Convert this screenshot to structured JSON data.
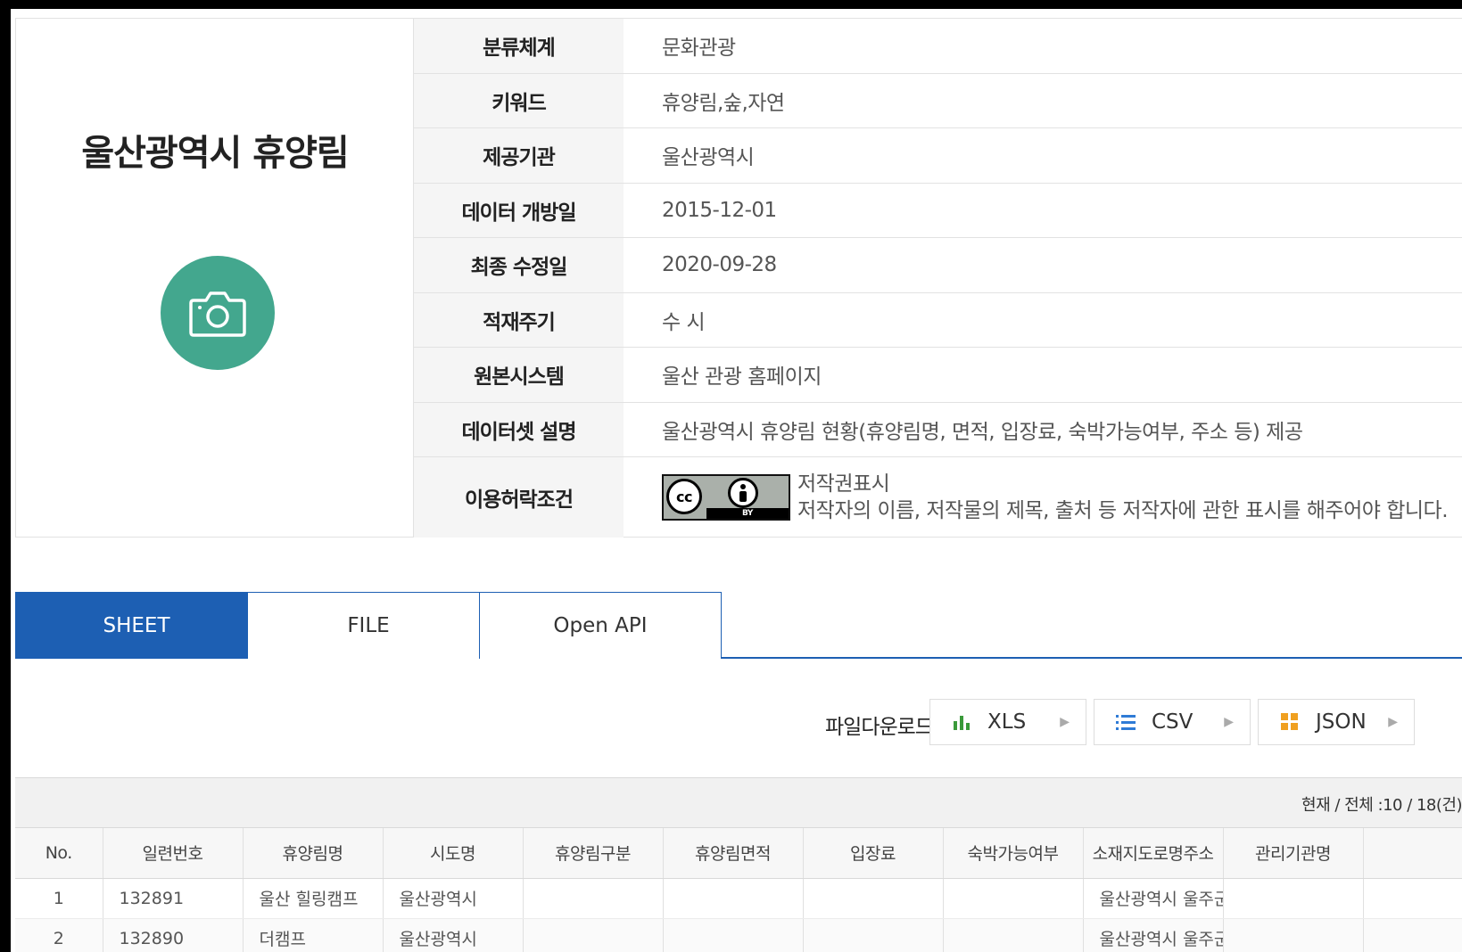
{
  "dataset": {
    "title": "울산광역시 휴양림",
    "thumbnail_icon": "camera-icon",
    "thumbnail_color": "#43a78e"
  },
  "meta": [
    {
      "key": "분류체계",
      "value": "문화관광"
    },
    {
      "key": "키워드",
      "value": "휴양림,숲,자연"
    },
    {
      "key": "제공기관",
      "value": "울산광역시"
    },
    {
      "key": "데이터 개방일",
      "value": "2015-12-01"
    },
    {
      "key": "최종 수정일",
      "value": "2020-09-28"
    },
    {
      "key": "적재주기",
      "value": "수 시"
    },
    {
      "key": "원본시스템",
      "value": "울산 관광 홈페이지"
    },
    {
      "key": "데이터셋 설명",
      "value": "울산광역시 휴양림 현황(휴양림명, 면적, 입장료, 숙박가능여부, 주소 등) 제공"
    }
  ],
  "license": {
    "key": "이용허락조건",
    "badge_cc": "cc",
    "badge_by": "BY",
    "line1": "저작권표시",
    "line2": "저작자의 이름, 저작물의 제목, 출처 등 저작자에 관한 표시를 해주어야 합니다."
  },
  "tabs": [
    {
      "label": "SHEET",
      "active": true
    },
    {
      "label": "FILE",
      "active": false
    },
    {
      "label": "Open API",
      "active": false
    }
  ],
  "download": {
    "label": "파일다운로드",
    "buttons": [
      {
        "label": "XLS",
        "icon": "bar-chart-icon",
        "color": "#3a9a3a"
      },
      {
        "label": "CSV",
        "icon": "list-icon",
        "color": "#2f7bd6"
      },
      {
        "label": "JSON",
        "icon": "grid-icon",
        "color": "#f0a020"
      }
    ],
    "arrow": "▶"
  },
  "grid": {
    "status": "현재 / 전체 :10 / 18(건)",
    "columns": [
      "No.",
      "일련번호",
      "휴양림명",
      "시도명",
      "휴양림구분",
      "휴양림면적",
      "입장료",
      "숙박가능여부",
      "소재지도로명주소",
      "관리기관명"
    ],
    "rows": [
      [
        "1",
        "132891",
        "울산 힐링캠프",
        "울산광역시",
        "",
        "",
        "",
        "",
        "울산광역시 울주군 상",
        ""
      ],
      [
        "2",
        "132890",
        "더캠프",
        "울산광역시",
        "",
        "",
        "",
        "",
        "울산광역시 울주군 상",
        ""
      ]
    ]
  }
}
